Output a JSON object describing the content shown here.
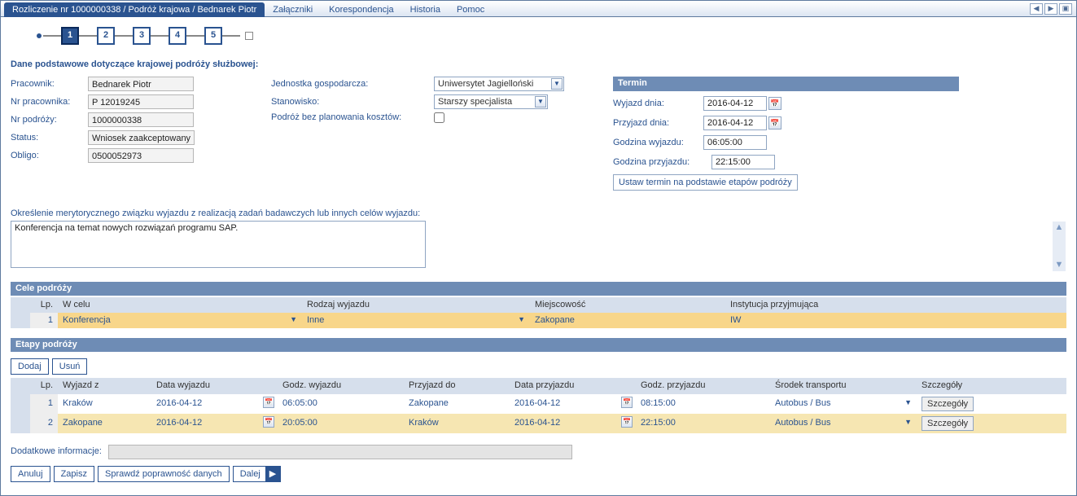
{
  "tabs": {
    "main": "Rozliczenie nr 1000000338 / Podróż krajowa / Bednarek Piotr",
    "attachments": "Załączniki",
    "correspondence": "Korespondencja",
    "history": "Historia",
    "help": "Pomoc"
  },
  "wizard": {
    "steps": [
      "1",
      "2",
      "3",
      "4",
      "5"
    ],
    "active": 0
  },
  "section_title": "Dane podstawowe dotyczące krajowej podróży służbowej:",
  "fields": {
    "pracownik_lbl": "Pracownik:",
    "pracownik_val": "Bednarek Piotr",
    "nrprac_lbl": "Nr pracownika:",
    "nrprac_val": "P 12019245",
    "nrpodr_lbl": "Nr podróży:",
    "nrpodr_val": "1000000338",
    "status_lbl": "Status:",
    "status_val": "Wniosek zaakceptowany",
    "obligo_lbl": "Obligo:",
    "obligo_val": "0500052973",
    "jednostka_lbl": "Jednostka gospodarcza:",
    "jednostka_val": "Uniwersytet Jagielloński",
    "stanowisko_lbl": "Stanowisko:",
    "stanowisko_val": "Starszy specjalista",
    "bezplan_lbl": "Podróż bez planowania kosztów:"
  },
  "termin": {
    "header": "Termin",
    "wyjazd_lbl": "Wyjazd dnia:",
    "wyjazd_val": "2016-04-12",
    "przyjazd_lbl": "Przyjazd dnia:",
    "przyjazd_val": "2016-04-12",
    "godz_w_lbl": "Godzina wyjazdu:",
    "godz_w_val": "06:05:00",
    "godz_p_lbl": "Godzina przyjazdu:",
    "godz_p_val": "22:15:00",
    "ustaw_btn": "Ustaw termin na podstawie etapów podróży"
  },
  "ta_label": "Określenie merytorycznego związku wyjazdu z realizacją zadań badawczych lub innych celów wyjazdu:",
  "ta_value": "Konferencja na temat nowych rozwiązań programu SAP.",
  "cele": {
    "header": "Cele podróży",
    "cols": {
      "lp": "Lp.",
      "wcelu": "W celu",
      "rodzaj": "Rodzaj wyjazdu",
      "miejscowosc": "Miejscowość",
      "instytucja": "Instytucja przyjmująca"
    },
    "rows": [
      {
        "lp": "1",
        "wcelu": "Konferencja",
        "rodzaj": "Inne",
        "miejscowosc": "Zakopane",
        "instytucja": "IW"
      }
    ]
  },
  "etapy": {
    "header": "Etapy podróży",
    "btn_add": "Dodaj",
    "btn_del": "Usuń",
    "cols": {
      "lp": "Lp.",
      "wyjazdz": "Wyjazd z",
      "datawy": "Data wyjazdu",
      "godzwy": "Godz. wyjazdu",
      "przyjazddo": "Przyjazd do",
      "dataprz": "Data przyjazdu",
      "godzprz": "Godz. przyjazdu",
      "srodek": "Środek transportu",
      "szczegoly": "Szczegóły"
    },
    "detail_btn": "Szczegóły",
    "rows": [
      {
        "lp": "1",
        "wyjazdz": "Kraków",
        "datawy": "2016-04-12",
        "godzwy": "06:05:00",
        "przyjazddo": "Zakopane",
        "dataprz": "2016-04-12",
        "godzprz": "08:15:00",
        "srodek": "Autobus / Bus"
      },
      {
        "lp": "2",
        "wyjazdz": "Zakopane",
        "datawy": "2016-04-12",
        "godzwy": "20:05:00",
        "przyjazddo": "Kraków",
        "dataprz": "2016-04-12",
        "godzprz": "22:15:00",
        "srodek": "Autobus / Bus"
      }
    ]
  },
  "addinfo_lbl": "Dodatkowe informacje:",
  "actions": {
    "anuluj": "Anuluj",
    "zapisz": "Zapisz",
    "sprawdz": "Sprawdź poprawność danych",
    "dalej": "Dalej"
  }
}
